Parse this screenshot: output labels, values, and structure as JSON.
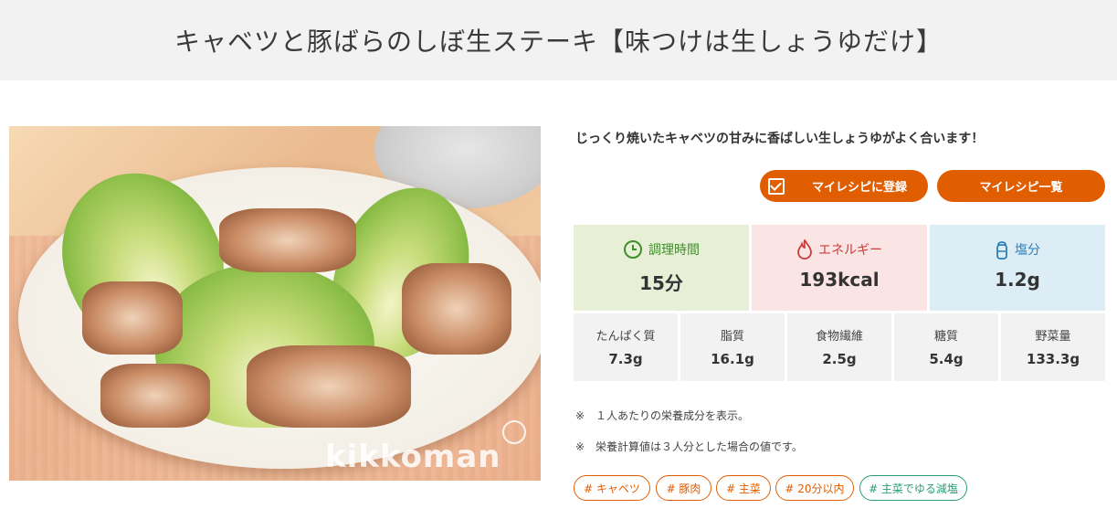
{
  "title": "キャベツと豚ばらのしぼ生ステーキ【味つけは生しょうゆだけ】",
  "photo": {
    "logo_text": "kikkoman"
  },
  "description": "じっくり焼いたキャベツの甘みに香ばしい生しょうゆがよく合います！",
  "buttons": {
    "register": "マイレシピに登録",
    "list": "マイレシピ一覧"
  },
  "stats": {
    "time": {
      "label": "調理時間",
      "value": "15分"
    },
    "energy": {
      "label": "エネルギー",
      "value": "193kcal"
    },
    "salt": {
      "label": "塩分",
      "value": "1.2g"
    }
  },
  "nutrition": [
    {
      "label": "たんぱく質",
      "value": "7.3g"
    },
    {
      "label": "脂質",
      "value": "16.1g"
    },
    {
      "label": "食物繊維",
      "value": "2.5g"
    },
    {
      "label": "糖質",
      "value": "5.4g"
    },
    {
      "label": "野菜量",
      "value": "133.3g"
    }
  ],
  "notes": [
    "※　１人あたりの栄養成分を表示。",
    "※　栄養計算値は３人分とした場合の値です。"
  ],
  "tags": [
    "# キャベツ",
    "# 豚肉",
    "# 主菜",
    "# 20分以内",
    "# 主菜でゆる減塩"
  ],
  "colors": {
    "accent": "#e05d00",
    "time_bg": "#e7f0d7",
    "energy_bg": "#fbe4e4",
    "salt_bg": "#dcedf6",
    "tag_green": "#2a9c7b"
  }
}
